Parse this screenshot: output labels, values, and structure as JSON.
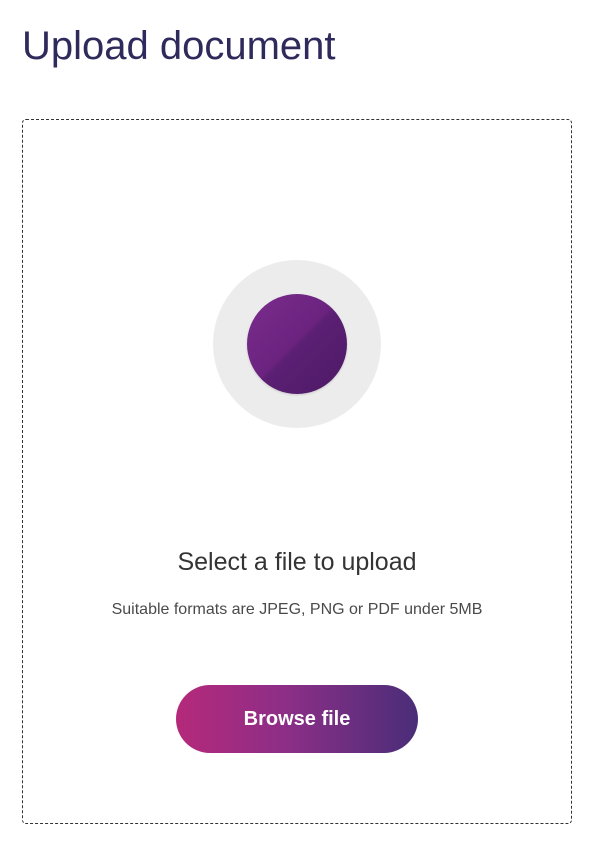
{
  "header": {
    "title": "Upload document"
  },
  "dropzone": {
    "instruction_title": "Select a file to upload",
    "instruction_subtitle": "Suitable formats are JPEG, PNG or PDF under 5MB",
    "browse_button_label": "Browse file"
  }
}
